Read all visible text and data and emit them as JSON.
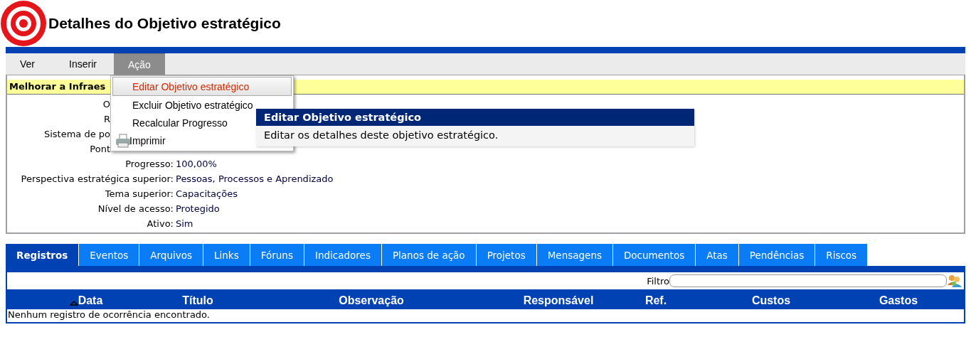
{
  "page": {
    "title": "Detalhes do Objetivo estratégico"
  },
  "menu_bar": [
    {
      "label": "Ver",
      "selected": false
    },
    {
      "label": "Inserir",
      "selected": false
    },
    {
      "label": "Ação",
      "selected": true
    }
  ],
  "dropdown": {
    "items": [
      {
        "label": "Editar Objetivo estratégico",
        "highlighted": true,
        "kind": "plain"
      },
      {
        "label": "Excluir Objetivo estratégico",
        "highlighted": false,
        "kind": "plain"
      },
      {
        "label": "Recalcular Progresso",
        "highlighted": false,
        "kind": "plain"
      },
      {
        "label": "Imprimir",
        "highlighted": false,
        "kind": "print"
      }
    ]
  },
  "tooltip": {
    "title": "Editar Objetivo estratégico",
    "text": "Editar os detalhes deste objetivo estratégico."
  },
  "details": {
    "heading": "Melhorar a Infraes",
    "rows": [
      {
        "label": "O",
        "kind": "covered"
      },
      {
        "label": "R",
        "kind": "covered"
      },
      {
        "label": "Sistema de po",
        "kind": "covered"
      },
      {
        "label": "Pont",
        "kind": "covered"
      },
      {
        "label": "Progresso:",
        "value": "100,00%",
        "kind": "full"
      },
      {
        "label": "Perspectiva estratégica superior:",
        "value": "Pessoas, Processos e Aprendizado",
        "kind": "full"
      },
      {
        "label": "Tema superior:",
        "value": "Capacitações",
        "kind": "full"
      },
      {
        "label": "Nível de acesso:",
        "value": "Protegido",
        "kind": "full"
      },
      {
        "label": "Ativo:",
        "value": "Sim",
        "kind": "full"
      }
    ]
  },
  "tabs": [
    {
      "label": "Registros",
      "selected": true
    },
    {
      "label": "Eventos",
      "selected": false
    },
    {
      "label": "Arquivos",
      "selected": false
    },
    {
      "label": "Links",
      "selected": false
    },
    {
      "label": "Fóruns",
      "selected": false
    },
    {
      "label": "Indicadores",
      "selected": false
    },
    {
      "label": "Planos de ação",
      "selected": false
    },
    {
      "label": "Projetos",
      "selected": false
    },
    {
      "label": "Mensagens",
      "selected": false
    },
    {
      "label": "Documentos",
      "selected": false
    },
    {
      "label": "Atas",
      "selected": false
    },
    {
      "label": "Pendências",
      "selected": false
    },
    {
      "label": "Riscos",
      "selected": false
    }
  ],
  "filter": {
    "label": "Filtro"
  },
  "table": {
    "columns": [
      {
        "label": "Data",
        "sorted": true
      },
      {
        "label": "Título",
        "sorted": false
      },
      {
        "label": "Observação",
        "sorted": false
      },
      {
        "label": "Responsável",
        "sorted": false
      },
      {
        "label": "Ref.",
        "sorted": false
      },
      {
        "label": "Custos",
        "sorted": false
      },
      {
        "label": "Gastos",
        "sorted": false
      }
    ],
    "empty_message": "Nenhum registro de ocorrência encontrado."
  }
}
